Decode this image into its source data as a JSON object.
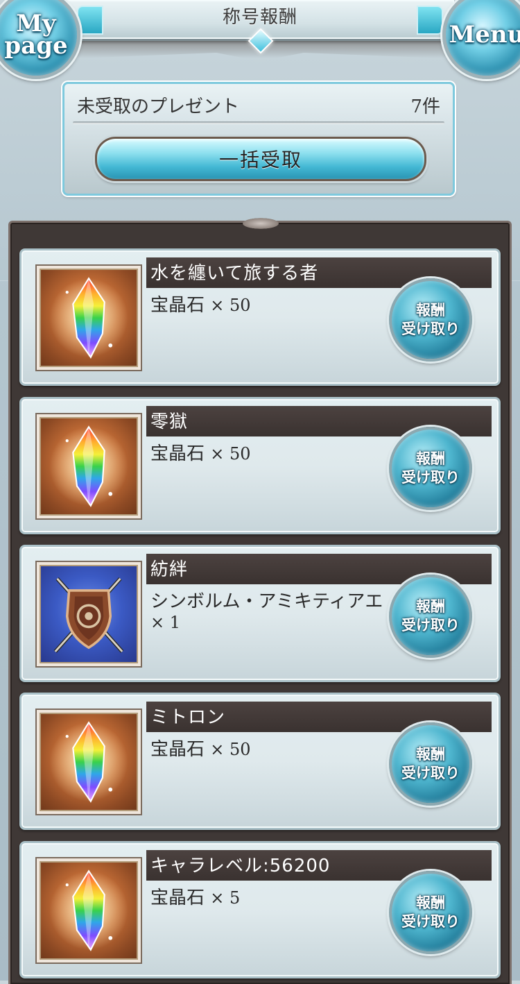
{
  "header": {
    "title": "称号報酬",
    "mypage_line1": "My",
    "mypage_line2": "page",
    "menu_label": "Menu"
  },
  "present": {
    "label": "未受取のプレゼント",
    "count": "7件",
    "bulk_button": "一括受取"
  },
  "rewards": [
    {
      "title": "水を纏いて旅する者",
      "item": "宝晶石",
      "qty": "× 50",
      "icon": "crystal-icon",
      "claim_line1": "報酬",
      "claim_line2": "受け取り"
    },
    {
      "title": "零獄",
      "item": "宝晶石",
      "qty": "× 50",
      "icon": "crystal-icon",
      "claim_line1": "報酬",
      "claim_line2": "受け取り"
    },
    {
      "title": "紡絆",
      "item": "シンボルム・アミキティアエ",
      "qty": "× 1",
      "icon": "shield-swords-icon",
      "claim_line1": "報酬",
      "claim_line2": "受け取り"
    },
    {
      "title": "ミトロン",
      "item": "宝晶石",
      "qty": "× 50",
      "icon": "crystal-icon",
      "claim_line1": "報酬",
      "claim_line2": "受け取り"
    },
    {
      "title": "キャラレベル:56200",
      "item": "宝晶石",
      "qty": "× 5",
      "icon": "crystal-icon",
      "claim_line1": "報酬",
      "claim_line2": "受け取り"
    }
  ],
  "colors": {
    "accent": "#43b8d4",
    "title_bar": "#3a3230",
    "frame": "#3f3836"
  }
}
